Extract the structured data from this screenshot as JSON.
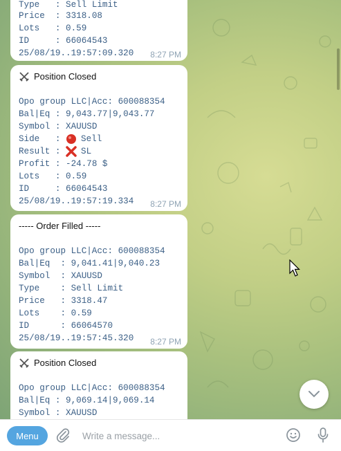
{
  "messages": [
    {
      "lines": [
        {
          "k": "Type   : ",
          "v": "Sell Limit"
        },
        {
          "k": "Price  : ",
          "v": "3318.08"
        },
        {
          "k": "Lots   : ",
          "v": "0.59"
        },
        {
          "k": "ID     : ",
          "v": "66064543"
        },
        {
          "k": "",
          "v": "25/08/19..19:57:09.320"
        }
      ],
      "time": "8:27 PM"
    },
    {
      "header": "Position Closed",
      "account": "Opo group LLC|Acc: 600088354",
      "bal": "Bal|Eq : 9,043.77|9,043.77",
      "symbol": {
        "k": "Symbol : ",
        "v": "XAUUSD"
      },
      "side": {
        "k": "Side   : ",
        "v": "Sell"
      },
      "result": {
        "k": "Result : ",
        "v": "SL"
      },
      "profit": {
        "k": "Profit : ",
        "v": "-24.78 $"
      },
      "lots": {
        "k": "Lots   : ",
        "v": "0.59"
      },
      "id": {
        "k": "ID     : ",
        "v": "66064543"
      },
      "stamp": "25/08/19..19:57:19.334",
      "time": "8:27 PM"
    },
    {
      "header": "----- Order Filled -----",
      "account": "Opo group LLC|Acc: 600088354",
      "bal": "Bal|Eq  : 9,041.41|9,040.23",
      "symbol": {
        "k": "Symbol  : ",
        "v": "XAUUSD"
      },
      "type": {
        "k": "Type    : ",
        "v": "Sell Limit"
      },
      "price": {
        "k": "Price   : ",
        "v": "3318.47"
      },
      "lots": {
        "k": "Lots    : ",
        "v": "0.59"
      },
      "id": {
        "k": "ID      : ",
        "v": "66064570"
      },
      "stamp": "25/08/19..19:57:45.320",
      "time": "8:27 PM"
    },
    {
      "header": "Position Closed",
      "account": "Opo group LLC|Acc: 600088354",
      "bal": "Bal|Eq : 9,069.14|9,069.14",
      "symbol": {
        "k": "Symbol : ",
        "v": "XAUUSD"
      }
    }
  ],
  "composer": {
    "menu_label": "Menu",
    "placeholder": "Write a message..."
  },
  "icons": {
    "position_closed": "crossed-swords-icon",
    "sell": "red-circle-icon",
    "sl": "red-x-icon",
    "attach": "paperclip-icon",
    "emoji": "smiley-icon",
    "mic": "microphone-icon",
    "scroll": "chevron-down-icon"
  },
  "colors": {
    "accent": "#54a5e0",
    "mono_text": "#3b5f86",
    "time_text": "#8fa3b4",
    "sell_red": "#d93025"
  }
}
